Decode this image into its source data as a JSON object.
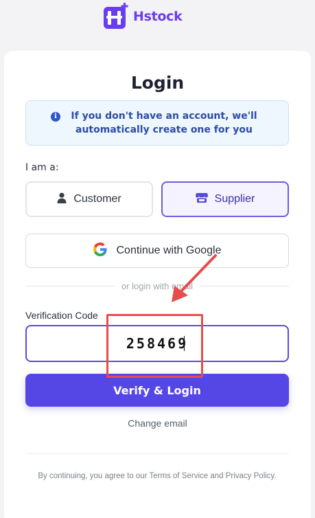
{
  "brand": {
    "name": "Hstock",
    "logo_icon": "h-plus-logo-icon",
    "color": "#6a3df0"
  },
  "login": {
    "title": "Login",
    "notice": "If you don't have an account, we'll automatically create one for you",
    "role_label": "I am a:",
    "roles": [
      {
        "label": "Customer",
        "icon": "person-icon",
        "selected": false
      },
      {
        "label": "Supplier",
        "icon": "store-icon",
        "selected": true
      }
    ],
    "google_button": "Continue with Google",
    "divider_text": "or login with email",
    "code_label": "Verification Code",
    "code_value": "258469",
    "verify_button": "Verify & Login",
    "change_email": "Change email",
    "terms": "By continuing, you agree to our Terms of Service and Privacy Policy."
  },
  "colors": {
    "accent": "#5547e5",
    "annotation": "#e74c4c",
    "info": "#2f55c9"
  }
}
